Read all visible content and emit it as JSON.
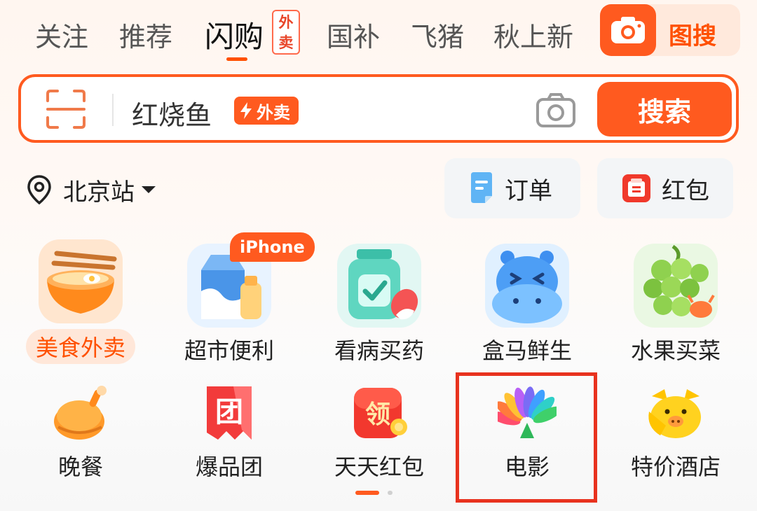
{
  "tabs": [
    {
      "label": "关注",
      "active": false
    },
    {
      "label": "推荐",
      "active": false
    },
    {
      "label": "闪购",
      "active": true,
      "tag": "外卖"
    },
    {
      "label": "国补",
      "active": false
    },
    {
      "label": "飞猪",
      "active": false
    },
    {
      "label": "秋上新",
      "active": false
    }
  ],
  "image_search": {
    "label": "图搜",
    "icon": "camera-icon"
  },
  "search": {
    "query": "红烧鱼",
    "badge": "外卖",
    "button_label": "搜索",
    "scan_icon": "scan-icon",
    "camera_icon": "camera-icon"
  },
  "location": {
    "label": "北京站",
    "icon": "location-pin-icon"
  },
  "quick_actions": [
    {
      "label": "订单",
      "icon": "order-icon"
    },
    {
      "label": "红包",
      "icon": "red-packet-icon"
    }
  ],
  "categories_row1": [
    {
      "label": "美食外卖",
      "icon": "noodle-bowl-icon",
      "highlighted": true
    },
    {
      "label": "超市便利",
      "icon": "milk-carton-icon",
      "badge": "iPhone"
    },
    {
      "label": "看病买药",
      "icon": "medicine-jar-icon"
    },
    {
      "label": "盒马鲜生",
      "icon": "hippo-icon"
    },
    {
      "label": "水果买菜",
      "icon": "grapes-icon"
    }
  ],
  "categories_row2": [
    {
      "label": "晚餐",
      "icon": "roast-chicken-icon"
    },
    {
      "label": "爆品团",
      "icon": "tuan-icon",
      "glyph": "团"
    },
    {
      "label": "天天红包",
      "icon": "ling-coupon-icon",
      "glyph": "领"
    },
    {
      "label": "电影",
      "icon": "movie-flower-icon",
      "annotated": true
    },
    {
      "label": "特价酒店",
      "icon": "pig-icon"
    }
  ],
  "pager": {
    "pages": 2,
    "current": 1
  },
  "colors": {
    "accent": "#ff5a1f",
    "highlight_box": "#e8321e"
  }
}
